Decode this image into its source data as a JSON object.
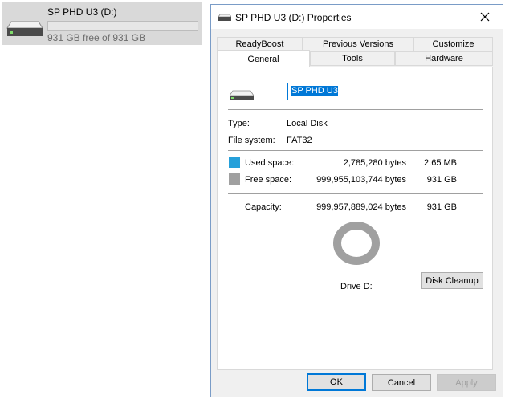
{
  "explorer_tile": {
    "drive_name": "SP PHD U3 (D:)",
    "free_text": "931 GB free of 931 GB",
    "used_fraction": 0.0
  },
  "dialog": {
    "title": "SP PHD U3 (D:) Properties",
    "tabs_row1": [
      "ReadyBoost",
      "Previous Versions",
      "Customize"
    ],
    "tabs_row2": [
      "General",
      "Tools",
      "Hardware"
    ],
    "active_tab": "General",
    "volume_label_value": "SP PHD U3",
    "type_label": "Type:",
    "type_value": "Local Disk",
    "fs_label": "File system:",
    "fs_value": "FAT32",
    "used": {
      "label": "Used space:",
      "bytes": "2,785,280 bytes",
      "size": "2.65 MB",
      "color": "#26a0da"
    },
    "free": {
      "label": "Free space:",
      "bytes": "999,955,103,744 bytes",
      "size": "931 GB",
      "color": "#a0a0a0"
    },
    "capacity": {
      "label": "Capacity:",
      "bytes": "999,957,889,024 bytes",
      "size": "931 GB"
    },
    "drive_caption": "Drive D:",
    "disk_cleanup_label": "Disk Cleanup",
    "buttons": {
      "ok": "OK",
      "cancel": "Cancel",
      "apply": "Apply"
    }
  },
  "icons": [
    "drive-icon",
    "close-icon"
  ]
}
